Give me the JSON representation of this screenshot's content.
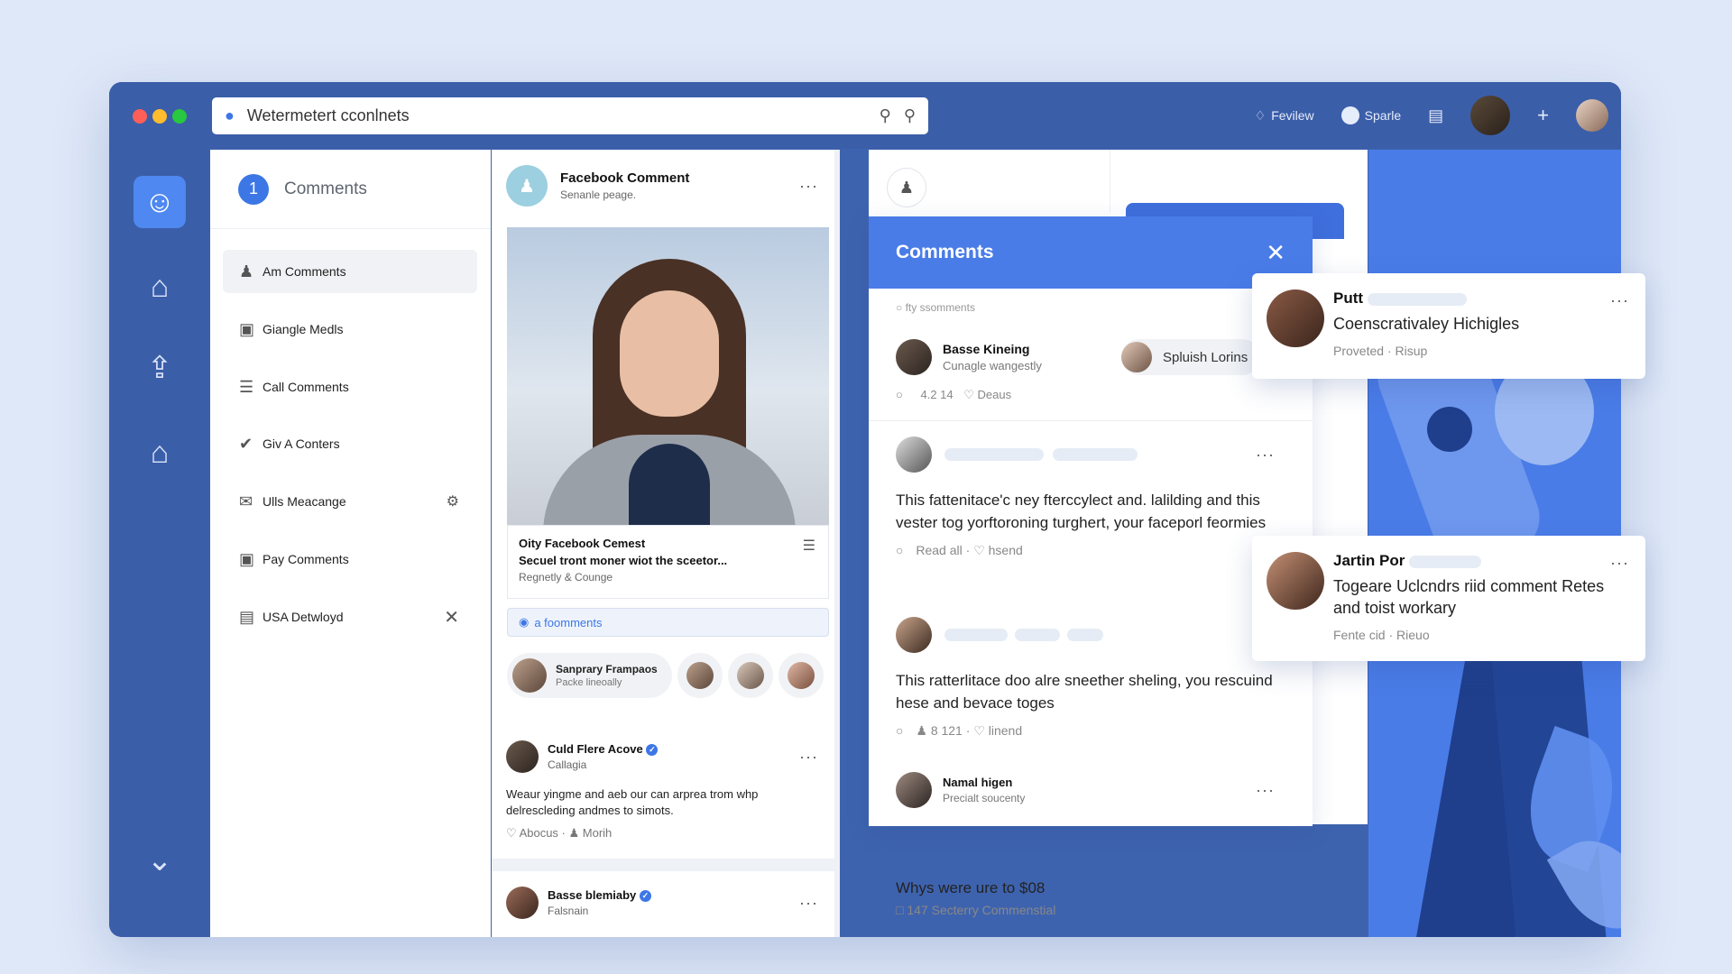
{
  "titlebar": {
    "search_text": "Wetermetert cconlnets",
    "right_items": [
      {
        "icon": "bell-icon",
        "label": "Fevilew"
      },
      {
        "icon": "globe-icon",
        "label": "Sparle"
      }
    ]
  },
  "rail": {
    "icons": [
      "chat-icon",
      "building-icon",
      "share-icon",
      "home-icon",
      "chevron-down-icon"
    ]
  },
  "nav": {
    "badge": "1",
    "title": "Comments",
    "items": [
      {
        "icon": "person-icon",
        "label": "Am Comments"
      },
      {
        "icon": "lock-icon",
        "label": "Giangle Medls"
      },
      {
        "icon": "list-icon",
        "label": "Call Comments"
      },
      {
        "icon": "check-circle-icon",
        "label": "Giv A Conters"
      },
      {
        "icon": "mail-icon",
        "label": "Ulls Meacange"
      },
      {
        "icon": "lock-icon",
        "label": "Pay Comments"
      },
      {
        "icon": "clipboard-icon",
        "label": "USA Detwloyd"
      }
    ]
  },
  "feed": {
    "post": {
      "name": "Facebook Comment",
      "sub": "Senanle peage.",
      "caption_title": "Oity Facebook Cemest",
      "caption_line": "Secuel tront moner wiot the sceetor...",
      "caption_sub": "Regnetly & Counge",
      "link_text": "a foomments",
      "reactor_name": "Sanprary Frampaos",
      "reactor_sub": "Packe lineoally"
    },
    "comment1": {
      "name": "Culd Flere Acove",
      "sub": "Callagia",
      "text": "Weaur yingme and aeb our can arprea trom whp delrescleding andmes to simots.",
      "meta1": "Abocus",
      "meta2": "Morih"
    },
    "comment2": {
      "name": "Basse blemiaby",
      "sub": "Falsnain"
    }
  },
  "panel": {
    "title": "Comments",
    "sub": "fty ssomments",
    "top": {
      "name": "Basse Kineing",
      "sub": "Cunagle wangestly",
      "meta1": "4.2 14",
      "meta2": "Deaus",
      "chip": "Spluish Lorins"
    },
    "c1": {
      "text": "This fattenitace'c ney fterccylect and. lalilding and this vester tog yorftoroning turghert, your faceporl feormies",
      "meta1": "Read all",
      "meta2": "hsend"
    },
    "c2": {
      "text": "This ratterlitace doo alre sneether sheling, you rescuind hese and bevace toges",
      "meta1": "8 121",
      "meta2": "linend"
    },
    "c3": {
      "name": "Namal higen",
      "sub": "Precialt soucenty"
    },
    "footer_text": "Whys were ure to $08",
    "footer_meta": "147 Secterry Commenstial"
  },
  "notifications": [
    {
      "name": "Putt",
      "text": "Coenscrativaley Hichigles",
      "meta1": "Proveted",
      "meta2": "Risup"
    },
    {
      "name": "Jartin Por",
      "text": "Togeare Uclcndrs riid comment Retes and toist workary",
      "meta1": "Fente cid",
      "meta2": "Rieuo"
    }
  ],
  "colors": {
    "window": "#3b5ea9",
    "accent": "#4a7ce8",
    "badge": "#3d77e6"
  }
}
